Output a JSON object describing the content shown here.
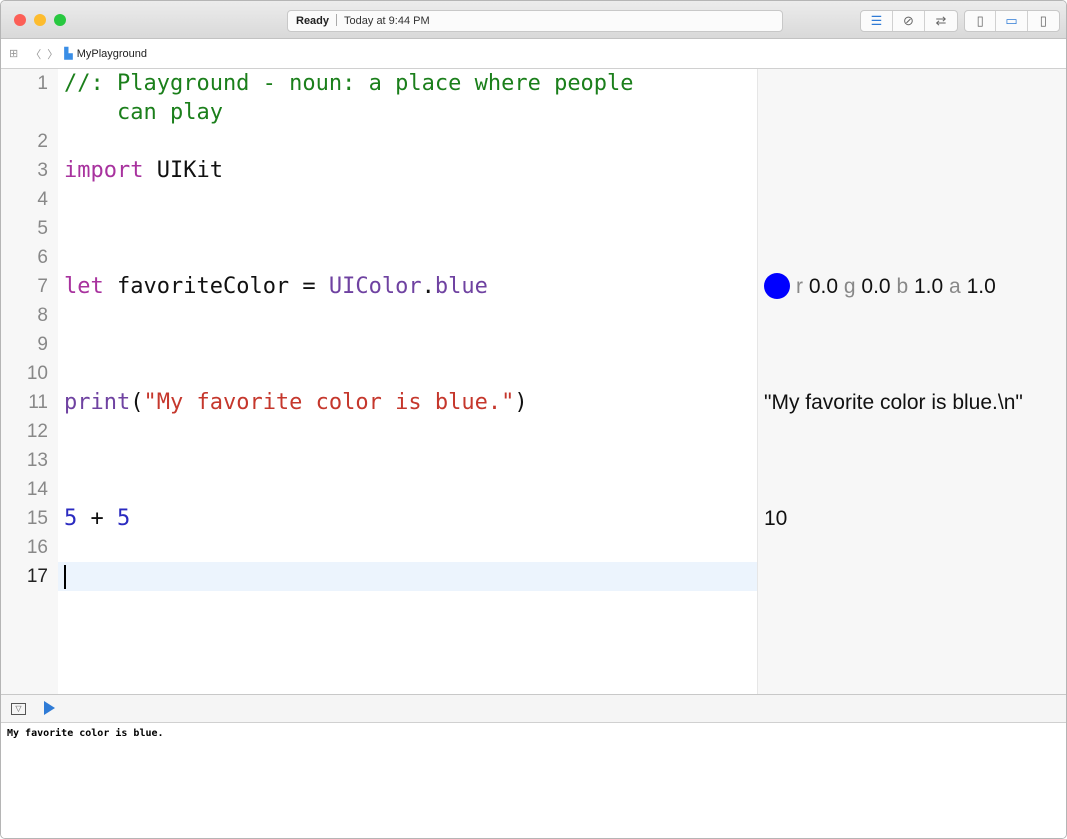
{
  "window": {
    "status": "Ready",
    "timestamp": "Today at 9:44 PM",
    "traffic_lights": [
      "#fc5f57",
      "#fdbc2e",
      "#28c840"
    ]
  },
  "nav": {
    "file_name": "MyPlayground",
    "grid_icon": "grid-icon",
    "back_icon": "chevron-left-icon",
    "forward_icon": "chevron-right-icon"
  },
  "toolbar": {
    "editor_buttons": [
      "standard-editor-icon",
      "assistant-editor-icon",
      "version-editor-icon"
    ],
    "panel_buttons": [
      "navigator-toggle-icon",
      "debug-area-toggle-icon",
      "utilities-toggle-icon"
    ],
    "accent": "#2f7bd6"
  },
  "editor": {
    "current_line": 17,
    "lines": [
      {
        "n": "1",
        "tokens": [
          {
            "t": "//: Playground - noun: a place where people",
            "c": "comment"
          }
        ]
      },
      {
        "n": "",
        "tokens": [
          {
            "t": "    can play",
            "c": "comment"
          }
        ]
      },
      {
        "n": "2",
        "tokens": []
      },
      {
        "n": "3",
        "tokens": [
          {
            "t": "import",
            "c": "kw"
          },
          {
            "t": " UIKit",
            "c": "plain"
          }
        ]
      },
      {
        "n": "4",
        "tokens": []
      },
      {
        "n": "5",
        "tokens": []
      },
      {
        "n": "6",
        "tokens": []
      },
      {
        "n": "7",
        "tokens": [
          {
            "t": "let",
            "c": "kw"
          },
          {
            "t": " favoriteColor = ",
            "c": "plain"
          },
          {
            "t": "UIColor",
            "c": "type"
          },
          {
            "t": ".",
            "c": "plain"
          },
          {
            "t": "blue",
            "c": "type"
          }
        ]
      },
      {
        "n": "8",
        "tokens": []
      },
      {
        "n": "9",
        "tokens": []
      },
      {
        "n": "10",
        "tokens": []
      },
      {
        "n": "11",
        "tokens": [
          {
            "t": "print",
            "c": "type"
          },
          {
            "t": "(",
            "c": "plain"
          },
          {
            "t": "\"My favorite color is blue.\"",
            "c": "str"
          },
          {
            "t": ")",
            "c": "plain"
          }
        ]
      },
      {
        "n": "12",
        "tokens": []
      },
      {
        "n": "13",
        "tokens": []
      },
      {
        "n": "14",
        "tokens": []
      },
      {
        "n": "15",
        "tokens": [
          {
            "t": "5",
            "c": "num"
          },
          {
            "t": " + ",
            "c": "plain"
          },
          {
            "t": "5",
            "c": "num"
          }
        ]
      },
      {
        "n": "16",
        "tokens": []
      },
      {
        "n": "17",
        "tokens": []
      }
    ]
  },
  "results": {
    "color": {
      "swatch": "#0000ff",
      "r_label": "r",
      "r": "0.0",
      "g_label": "g",
      "g": "0.0",
      "b_label": "b",
      "b": "1.0",
      "a_label": "a",
      "a": "1.0"
    },
    "print": "\"My favorite color is blue.\\n\"",
    "sum": "10"
  },
  "debug": {
    "toggle_icon": "hide-debug-area-icon",
    "run_icon": "play-icon",
    "console_output": "My favorite color is blue."
  }
}
